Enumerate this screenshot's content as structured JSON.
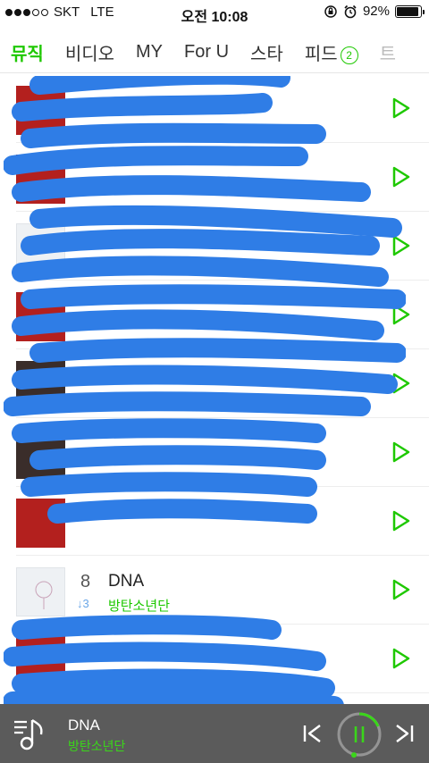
{
  "status": {
    "carrier": "SKT",
    "network": "LTE",
    "time": "오전 10:08",
    "battery": "92%",
    "battery_level": 0.92
  },
  "tabs": [
    {
      "label": "뮤직",
      "active": true
    },
    {
      "label": "비디오"
    },
    {
      "label": "MY"
    },
    {
      "label": "For U"
    },
    {
      "label": "스타"
    },
    {
      "label": "피드",
      "badge": "2"
    },
    {
      "label": "트"
    }
  ],
  "list": {
    "visible_item": {
      "rank": "8",
      "change": "↓3",
      "title": "DNA",
      "artist": "방탄소년단"
    }
  },
  "player": {
    "title": "DNA",
    "artist": "방탄소년단"
  },
  "colors": {
    "accent": "#1ec800",
    "scribble": "#2f7de6",
    "player_bg": "#5b5b5b"
  }
}
